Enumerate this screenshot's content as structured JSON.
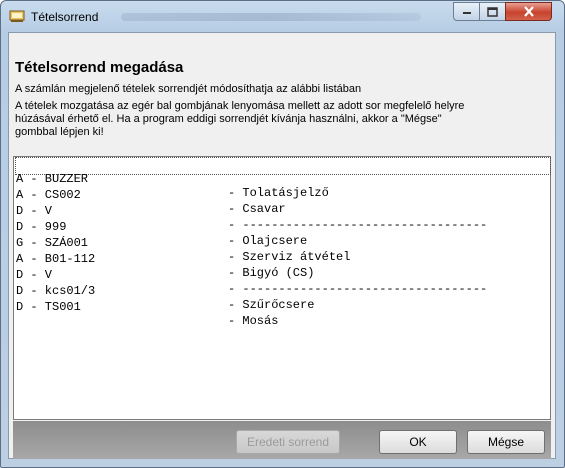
{
  "window": {
    "title": "Tételsorrend"
  },
  "dialog": {
    "heading": "Tételsorrend megadása",
    "desc1": "A számlán megjelenő tételek sorrendjét módosíthatja az alábbi listában",
    "desc2": "A tételek mozgatása az egér bal gombjának lenyomása mellett az adott sor megfelelő helyre",
    "desc3": "húzásával érhető el. Ha a program eddigi sorrendjét kívánja használni, akkor a \"Mégse\"",
    "desc4": "gombbal lépjen ki!"
  },
  "items": [
    {
      "code": "A - BUZZER",
      "name": "- Tolatásjelző"
    },
    {
      "code": "A - CS002",
      "name": "- Csavar"
    },
    {
      "code": "D - V",
      "name": "- ----------------------------------"
    },
    {
      "code": "D - 999",
      "name": "- Olajcsere"
    },
    {
      "code": "G - SZÁ001",
      "name": "- Szerviz átvétel"
    },
    {
      "code": "A - B01-112",
      "name": "- Bigyó (CS)"
    },
    {
      "code": "D - V",
      "name": "- ----------------------------------"
    },
    {
      "code": "D - kcs01/3",
      "name": "- Szűrőcsere"
    },
    {
      "code": "D - TS001",
      "name": "- Mosás"
    }
  ],
  "buttons": {
    "reset": "Eredeti sorrend",
    "ok": "OK",
    "cancel": "Mégse"
  }
}
